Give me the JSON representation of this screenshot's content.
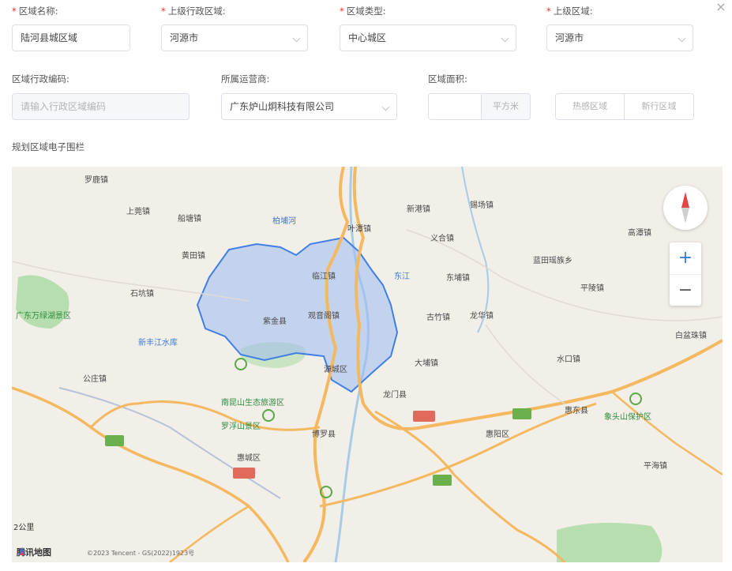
{
  "form": {
    "region_name": {
      "label": "区域名称:",
      "value": "陆河县城区域"
    },
    "parent_admin": {
      "label": "上级行政区域:",
      "value": "河源市"
    },
    "region_type": {
      "label": "区域类型:",
      "value": "中心城区"
    },
    "parent_region": {
      "label": "上级区域:",
      "value": "河源市"
    },
    "admin_code": {
      "label": "区域行政编码:",
      "placeholder": "请输入行政区域编码"
    },
    "operator": {
      "label": "所属运营商:",
      "value": "广东炉山炯科技有限公司"
    },
    "area": {
      "label": "区域面积:",
      "value": "",
      "unit": "平方米"
    },
    "draw_buttons": [
      "热感区域",
      "新行区域"
    ],
    "draw_label": "规划区域电子围栏"
  },
  "close_label": "×",
  "map": {
    "places": [
      {
        "t": "罗鹿镇",
        "c": ""
      },
      {
        "t": "上莞镇",
        "c": ""
      },
      {
        "t": "船塘镇",
        "c": ""
      },
      {
        "t": "黄田镇",
        "c": ""
      },
      {
        "t": "石坑镇",
        "c": ""
      },
      {
        "t": "柏埔河",
        "c": "blue"
      },
      {
        "t": "叶潭镇",
        "c": ""
      },
      {
        "t": "新港镇",
        "c": ""
      },
      {
        "t": "锡场镇",
        "c": ""
      },
      {
        "t": "义合镇",
        "c": ""
      },
      {
        "t": "紫金县",
        "c": ""
      },
      {
        "t": "东埔镇",
        "c": ""
      },
      {
        "t": "古竹镇",
        "c": ""
      },
      {
        "t": "新丰江水库",
        "c": "blue"
      },
      {
        "t": "东江",
        "c": "blue"
      },
      {
        "t": "临江镇",
        "c": ""
      },
      {
        "t": "观音阁镇",
        "c": ""
      },
      {
        "t": "龙门县",
        "c": ""
      },
      {
        "t": "博罗县",
        "c": ""
      },
      {
        "t": "惠阳区",
        "c": ""
      },
      {
        "t": "惠城区",
        "c": ""
      },
      {
        "t": "大埔镇",
        "c": ""
      },
      {
        "t": "水口镇",
        "c": ""
      },
      {
        "t": "广东万绿湖景区",
        "c": "green"
      },
      {
        "t": "南昆山生态旅游区",
        "c": "green"
      },
      {
        "t": "罗浮山景区",
        "c": "green"
      },
      {
        "t": "惠东县",
        "c": ""
      },
      {
        "t": "平海镇",
        "c": ""
      },
      {
        "t": "蓝田瑶族乡",
        "c": ""
      },
      {
        "t": "平陵镇",
        "c": ""
      },
      {
        "t": "高潭镇",
        "c": ""
      },
      {
        "t": "白盆珠镇",
        "c": ""
      },
      {
        "t": "公庄镇",
        "c": ""
      },
      {
        "t": "龙华镇",
        "c": ""
      },
      {
        "t": "象头山保护区",
        "c": "green"
      },
      {
        "t": "源城区",
        "c": ""
      }
    ],
    "scale_label": "2公里",
    "logo_label": "腾讯地图",
    "copyright": "©2023 Tencent - GS(2022)1923号"
  },
  "colors": {
    "polygon_fill": "#9fbbf0",
    "polygon_stroke": "#3f7fe6",
    "road": "#f4b860",
    "water": "#a8cbe8",
    "green": "#a8d9a0",
    "land": "#f2efe9"
  }
}
